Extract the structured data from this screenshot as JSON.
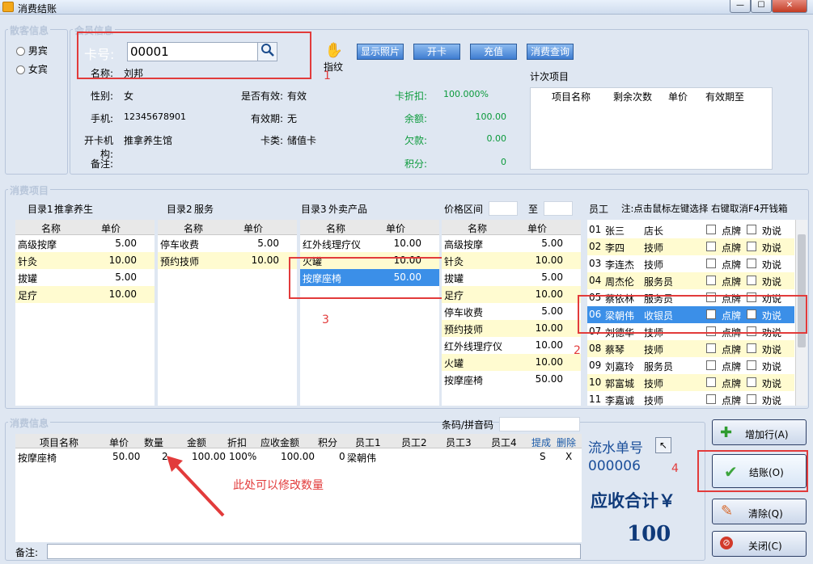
{
  "window": {
    "title": "消费结账",
    "min": "—",
    "max": "☐",
    "close": "✕"
  },
  "guest": {
    "legend": "散客信息",
    "male": "男宾",
    "female": "女宾"
  },
  "member": {
    "legend": "会员信息",
    "card_label": "卡号:",
    "card_value": "00001",
    "fingerprint": "指纹",
    "buttons": [
      "显示照片",
      "开卡",
      "充值",
      "消费查询"
    ],
    "name_label": "名称:",
    "name": "刘邦",
    "gender_label": "性别:",
    "gender": "女",
    "valid_label": "是否有效:",
    "valid": "有效",
    "discount_label": "卡折扣:",
    "discount": "100.000%",
    "phone_label": "手机:",
    "phone": "12345678901",
    "expire_label": "有效期:",
    "expire": "无",
    "balance_label": "余额:",
    "balance": "100.00",
    "org_label": "开卡机构:",
    "org": "推拿养生馆",
    "type_label": "卡类:",
    "type": "储值卡",
    "debt_label": "欠款:",
    "debt": "0.00",
    "note_label": "备注:",
    "points_label": "积分:",
    "points": "0",
    "count_title": "计次项目",
    "count_headers": [
      "项目名称",
      "剩余次数",
      "单价",
      "有效期至"
    ]
  },
  "items": {
    "legend": "消费项目",
    "cat1_label": "目录1",
    "cat1_value": "推拿养生",
    "cat2_label": "目录2",
    "cat2_value": "服务",
    "cat3_label": "目录3",
    "cat3_value": "外卖产品",
    "price_range_label": "价格区间",
    "to": "至",
    "col_name": "名称",
    "col_price": "单价",
    "list1": [
      [
        "高级按摩",
        "5.00"
      ],
      [
        "针灸",
        "10.00"
      ],
      [
        "拔罐",
        "5.00"
      ],
      [
        "足疗",
        "10.00"
      ]
    ],
    "list2": [
      [
        "停车收费",
        "5.00"
      ],
      [
        "预约技师",
        "10.00"
      ]
    ],
    "list3": [
      [
        "红外线理疗仪",
        "10.00"
      ],
      [
        "火罐",
        "10.00"
      ],
      [
        "按摩座椅",
        "50.00"
      ]
    ],
    "list4": [
      [
        "高级按摩",
        "5.00"
      ],
      [
        "针灸",
        "10.00"
      ],
      [
        "拔罐",
        "5.00"
      ],
      [
        "足疗",
        "10.00"
      ],
      [
        "停车收费",
        "5.00"
      ],
      [
        "预约技师",
        "10.00"
      ],
      [
        "红外线理疗仪",
        "10.00"
      ],
      [
        "火罐",
        "10.00"
      ],
      [
        "按摩座椅",
        "50.00"
      ]
    ]
  },
  "staff": {
    "title": "员工",
    "note": "注:点击鼠标左键选择 右键取消F4开钱箱",
    "pai": "点牌",
    "quan": "劝说",
    "rows": [
      [
        "01",
        "张三",
        "店长"
      ],
      [
        "02",
        "李四",
        "技师"
      ],
      [
        "03",
        "李连杰",
        "技师"
      ],
      [
        "04",
        "周杰伦",
        "服务员"
      ],
      [
        "05",
        "蔡依林",
        "服务员"
      ],
      [
        "06",
        "梁朝伟",
        "收银员"
      ],
      [
        "07",
        "刘德华",
        "技师"
      ],
      [
        "08",
        "蔡琴",
        "技师"
      ],
      [
        "09",
        "刘嘉玲",
        "服务员"
      ],
      [
        "10",
        "郭富城",
        "技师"
      ],
      [
        "11",
        "李嘉诚",
        "技师"
      ]
    ]
  },
  "consume": {
    "legend": "消费信息",
    "barcode_label": "条码/拼音码",
    "headers": [
      "项目名称",
      "单价",
      "数量",
      "金额",
      "折扣",
      "应收金额",
      "积分",
      "员工1",
      "员工2",
      "员工3",
      "员工4",
      "提成",
      "删除"
    ],
    "row": [
      "按摩座椅",
      "50.00",
      "2",
      "100.00",
      "100%",
      "100.00",
      "0",
      "梁朝伟",
      "",
      "",
      "",
      "S",
      "X"
    ],
    "note_label": "备注:"
  },
  "summary": {
    "serial_label": "流水单号",
    "serial": "000006",
    "total_label": "应收合计￥",
    "total": "100"
  },
  "actions": {
    "add": "增加行(A)",
    "checkout": "结账(O)",
    "clear": "清除(Q)",
    "close": "关闭(C)"
  },
  "annotations": {
    "n1": "1",
    "n2": "2",
    "n3": "3",
    "n4": "4",
    "qty_hint": "此处可以修改数量"
  }
}
